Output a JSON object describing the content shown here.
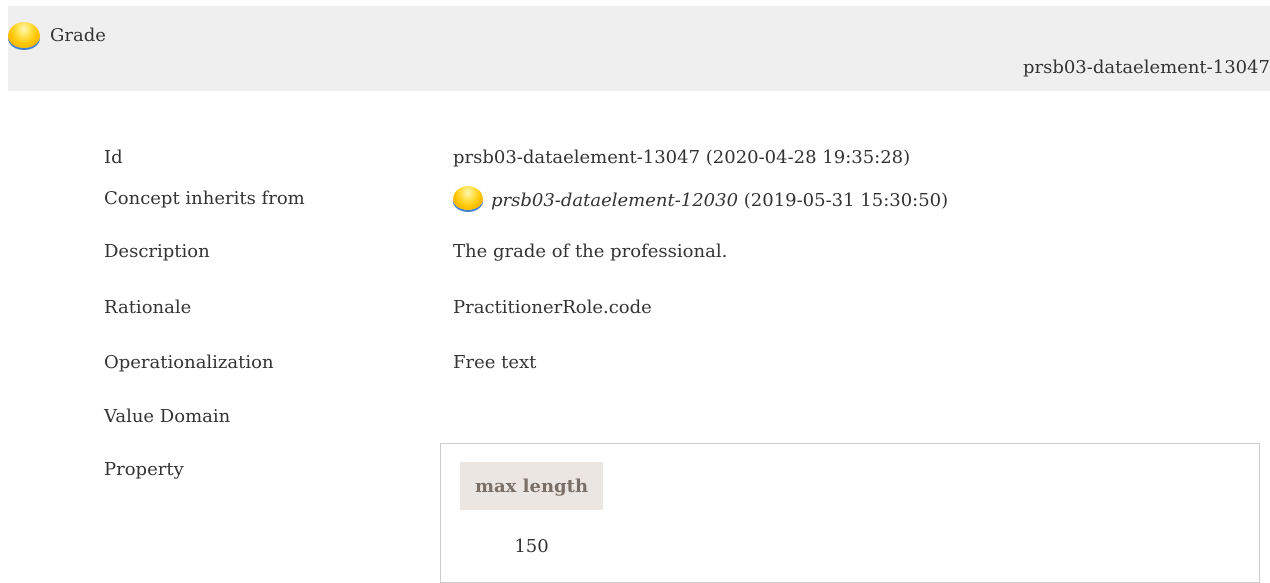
{
  "header": {
    "title": "Grade",
    "element_id": "prsb03-dataelement-13047"
  },
  "fields": {
    "id": {
      "label": "Id",
      "value": "prsb03-dataelement-13047 (2020-04-28 19:35:28)"
    },
    "inherits": {
      "label": "Concept inherits from",
      "link": "prsb03-dataelement-12030",
      "suffix": " (2019-05-31 15:30:50)"
    },
    "description": {
      "label": "Description",
      "value": "The grade of the professional."
    },
    "rationale": {
      "label": "Rationale",
      "value": "PractitionerRole.code"
    },
    "operationalization": {
      "label": "Operationalization",
      "value": "Free text"
    },
    "value_domain": {
      "label": "Value Domain",
      "value": ""
    },
    "property": {
      "label": "Property"
    }
  },
  "property_table": {
    "header": "max length",
    "value": "150"
  },
  "icons": {
    "status_icon": "yellow-status-orb-icon"
  },
  "colors": {
    "header_bg": "#efefef",
    "property_header_bg": "#ebe6e2",
    "property_header_text": "#7a6f67",
    "orb": "#ffc400"
  }
}
